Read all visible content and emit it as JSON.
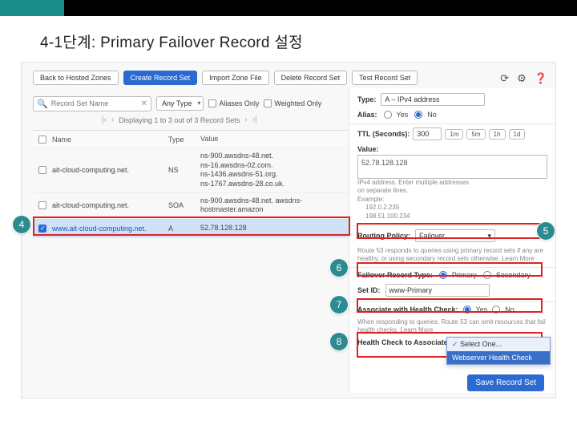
{
  "slide_title": "4-1단계: Primary Failover Record 설정",
  "toolbar": {
    "back": "Back to Hosted Zones",
    "create": "Create Record Set",
    "import": "Import Zone File",
    "delete": "Delete Record Set",
    "test": "Test Record Set"
  },
  "filters": {
    "search_ph": "Record Set Name",
    "type_dd": "Any Type",
    "aliases": "Aliases Only",
    "weighted": "Weighted Only"
  },
  "pager": {
    "text": "Displaying 1 to 3 out of 3 Record Sets"
  },
  "table": {
    "head": {
      "name": "Name",
      "type": "Type",
      "value": "Value"
    },
    "rows": [
      {
        "name": "ait-cloud-computing.net.",
        "type": "NS",
        "value": "ns-900.awsdns-48.net.\nns-16.awsdns-02.com.\nns-1436.awsdns-51.org.\nns-1767.awsdns-28.co.uk."
      },
      {
        "name": "ait-cloud-computing.net.",
        "type": "SOA",
        "value": "ns-900.awsdns-48.net. awsdns-hostmaster.amazon"
      },
      {
        "name": "www.ait-cloud-computing.net.",
        "type": "A",
        "value": "52.78.128.128"
      }
    ]
  },
  "panel": {
    "type_lbl": "Type:",
    "type_val": "A – IPv4 address",
    "alias_lbl": "Alias:",
    "alias_yes": "Yes",
    "alias_no": "No",
    "ttl_lbl": "TTL (Seconds):",
    "ttl_val": "300",
    "ttl_btns": [
      "1m",
      "5m",
      "1h",
      "1d"
    ],
    "value_lbl": "Value:",
    "value_val": "52.78.128.128",
    "ipv4_hint1": "IPv4 address. Enter multiple addresses",
    "ipv4_hint2": "on separate lines.",
    "ipv4_hint3": "Example:",
    "ipv4_ex1": "192.0.2.235",
    "ipv4_ex2": "198.51.100.234",
    "rp_lbl": "Routing Policy:",
    "rp_val": "Failover",
    "rp_hint": "Route 53 responds to queries using primary record sets if any are healthy, or using secondary record sets otherwise. Learn More",
    "fo_lbl": "Failover Record Type:",
    "fo_primary": "Primary",
    "fo_secondary": "Secondary",
    "setid_lbl": "Set ID:",
    "setid_val": "www-Primary",
    "hc_lbl": "Associate with Health Check:",
    "hc_yes": "Yes",
    "hc_no": "No",
    "hc_hint": "When responding to queries, Route 53 can omit resources that fail health checks. Learn More",
    "hc2_lbl": "Health Check to Associate:",
    "hc_dd_o1": "Select One...",
    "hc_dd_o2": "Webserver Health Check",
    "save": "Save Record Set"
  },
  "markers": {
    "m4": "4",
    "m5": "5",
    "m6": "6",
    "m7": "7",
    "m8": "8"
  }
}
